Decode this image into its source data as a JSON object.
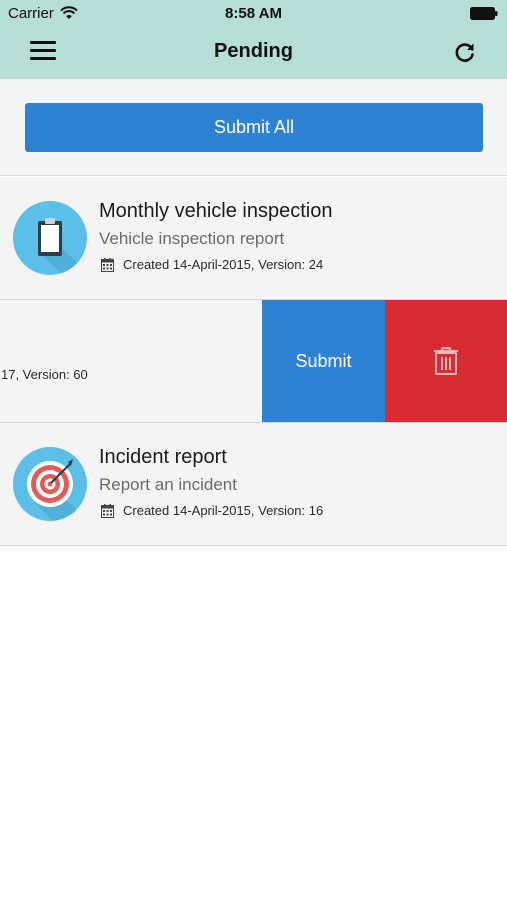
{
  "status_bar": {
    "carrier": "Carrier",
    "time": "8:58 AM",
    "wifi_icon": "wifi-icon",
    "battery_icon": "battery-icon"
  },
  "nav": {
    "title": "Pending",
    "menu_icon": "hamburger-menu-icon",
    "refresh_icon": "refresh-icon"
  },
  "actions": {
    "submit_all_label": "Submit All"
  },
  "items": [
    {
      "title": "Monthly vehicle inspection",
      "subtitle": "Vehicle inspection report",
      "meta": "Created 14-April-2015, Version: 24",
      "icon": "clipboard-icon"
    },
    {
      "meta_visible": "17, Version: 60",
      "swipe_submit_label": "Submit",
      "swipe_delete_icon": "trash-icon"
    },
    {
      "title": "Incident report",
      "subtitle": "Report an incident",
      "meta": "Created 14-April-2015, Version: 16",
      "icon": "target-icon"
    }
  ],
  "colors": {
    "header_bg": "#b6ddd6",
    "primary_blue": "#2d82d4",
    "delete_red": "#d92b33",
    "row_bg": "#f4f4f4"
  }
}
